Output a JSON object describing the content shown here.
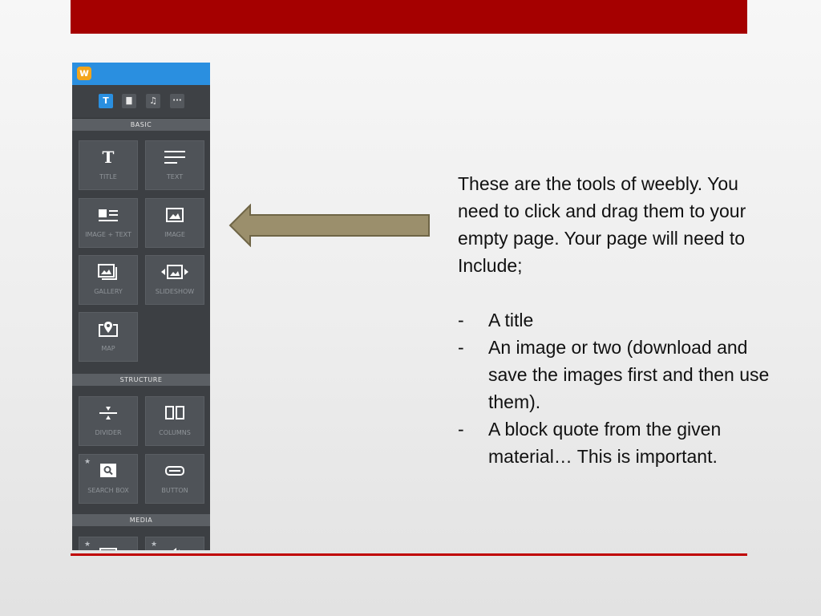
{
  "slide": {
    "intro": "These are the tools of weebly. You need to click and drag them to your empty page. Your page will need to Include;",
    "bullets": [
      "A title",
      "An image or two (download and save the images first and then use them).",
      "A block quote from the given material…  This is important."
    ],
    "bullet_marker": "-"
  },
  "panel": {
    "logo": "w",
    "tabs": [
      {
        "icon": "text-icon",
        "glyph": "T",
        "active": true
      },
      {
        "icon": "layout-icon",
        "glyph": "▇",
        "active": false
      },
      {
        "icon": "music-icon",
        "glyph": "♫",
        "active": false
      },
      {
        "icon": "more-icon",
        "glyph": "···",
        "active": false
      }
    ],
    "sections": {
      "basic": "BASIC",
      "structure": "STRUCTURE",
      "media": "MEDIA"
    },
    "basic_items": [
      {
        "label": "TITLE",
        "icon": "title-icon"
      },
      {
        "label": "TEXT",
        "icon": "text-lines-icon"
      },
      {
        "label": "IMAGE + TEXT",
        "icon": "image-text-icon"
      },
      {
        "label": "IMAGE",
        "icon": "image-icon"
      },
      {
        "label": "GALLERY",
        "icon": "gallery-icon"
      },
      {
        "label": "SLIDESHOW",
        "icon": "slideshow-icon"
      },
      {
        "label": "MAP",
        "icon": "map-pin-icon"
      }
    ],
    "structure_items": [
      {
        "label": "DIVIDER",
        "icon": "divider-icon"
      },
      {
        "label": "COLUMNS",
        "icon": "columns-icon"
      },
      {
        "label": "SEARCH BOX",
        "icon": "search-icon",
        "starred": true
      },
      {
        "label": "BUTTON",
        "icon": "button-icon"
      }
    ]
  },
  "colors": {
    "accent_red": "#a50000",
    "panel_bg": "#3c3f43",
    "weebly_blue": "#2a8fe0",
    "arrow_fill": "#9b8f6c"
  }
}
